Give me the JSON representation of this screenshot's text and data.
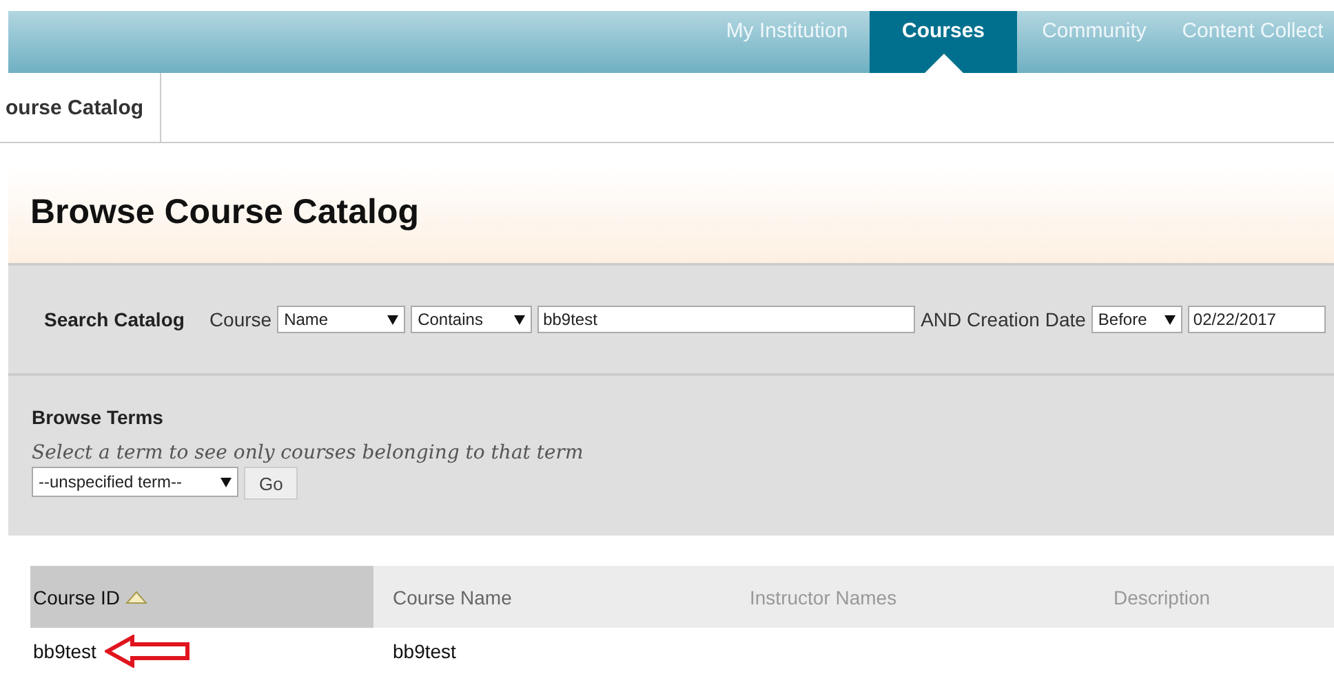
{
  "nav": {
    "tabs": [
      {
        "label": "My Institution",
        "selected": false
      },
      {
        "label": "Courses",
        "selected": true
      },
      {
        "label": "Community",
        "selected": false
      },
      {
        "label": "Content Collect",
        "selected": false
      }
    ]
  },
  "breadcrumb": "ourse Catalog",
  "title": "Browse Course Catalog",
  "search": {
    "label": "Search Catalog",
    "course_label": "Course",
    "field": "Name",
    "operator": "Contains",
    "value": "bb9test",
    "date_label": "AND Creation Date",
    "date_operator": "Before",
    "date": "02/22/2017"
  },
  "terms": {
    "heading": "Browse Terms",
    "hint": "Select a term to see only courses belonging to that term",
    "term": "--unspecified term--",
    "go": "Go"
  },
  "table": {
    "columns": [
      {
        "label": "Course ID",
        "sorted": true
      },
      {
        "label": "Course Name",
        "sorted": false
      },
      {
        "label": "Instructor Names",
        "sorted": false
      },
      {
        "label": "Description",
        "sorted": false
      }
    ],
    "rows": [
      {
        "cells": [
          "bb9test",
          "bb9test"
        ],
        "pointed": true
      }
    ]
  }
}
